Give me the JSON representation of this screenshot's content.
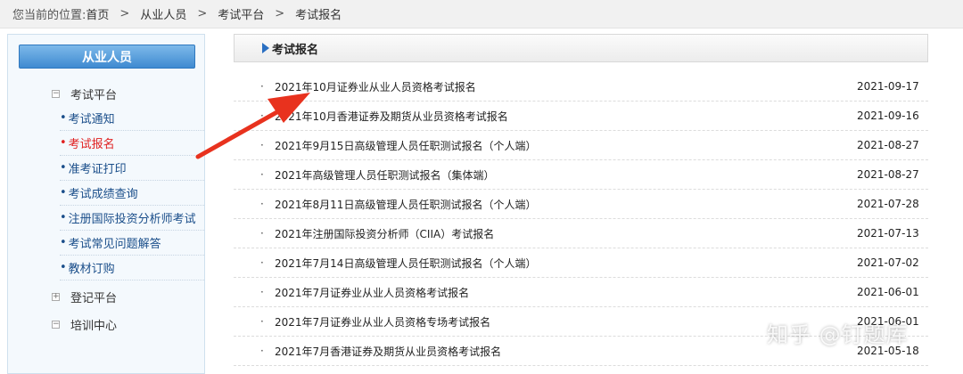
{
  "breadcrumb": {
    "prefix": "您当前的位置:",
    "items": [
      "首页",
      "从业人员",
      "考试平台",
      "考试报名"
    ]
  },
  "sidebar": {
    "header": "从业人员",
    "groups": [
      {
        "label": "考试平台",
        "toggle": "−"
      },
      {
        "label": "登记平台",
        "toggle": "+"
      },
      {
        "label": "培训中心",
        "toggle": "−"
      }
    ],
    "items": [
      {
        "label": "考试通知"
      },
      {
        "label": "考试报名"
      },
      {
        "label": "准考证打印"
      },
      {
        "label": "考试成绩查询"
      },
      {
        "label": "注册国际投资分析师考试"
      },
      {
        "label": "考试常见问题解答"
      },
      {
        "label": "教材订购"
      }
    ],
    "active_item": "考试报名",
    "bullet": "•"
  },
  "content": {
    "title": "考试报名",
    "rows": [
      {
        "title": "2021年10月证券业从业人员资格考试报名",
        "date": "2021-09-17"
      },
      {
        "title": "2021年10月香港证券及期货从业员资格考试报名",
        "date": "2021-09-16"
      },
      {
        "title": "2021年9月15日高级管理人员任职测试报名（个人端）",
        "date": "2021-08-27"
      },
      {
        "title": "2021年高级管理人员任职测试报名（集体端）",
        "date": "2021-08-27"
      },
      {
        "title": "2021年8月11日高级管理人员任职测试报名（个人端）",
        "date": "2021-07-28"
      },
      {
        "title": "2021年注册国际投资分析师（CIIA）考试报名",
        "date": "2021-07-13"
      },
      {
        "title": "2021年7月14日高级管理人员任职测试报名（个人端）",
        "date": "2021-07-02"
      },
      {
        "title": "2021年7月证券业从业人员资格考试报名",
        "date": "2021-06-01"
      },
      {
        "title": "2021年7月证券业从业人员资格专场考试报名",
        "date": "2021-06-01"
      },
      {
        "title": "2021年7月香港证券及期货从业员资格考试报名",
        "date": "2021-05-18"
      }
    ],
    "bullet": "·"
  },
  "annotation": {
    "color": "#e8321e"
  },
  "watermark": "知乎 @钉题库"
}
